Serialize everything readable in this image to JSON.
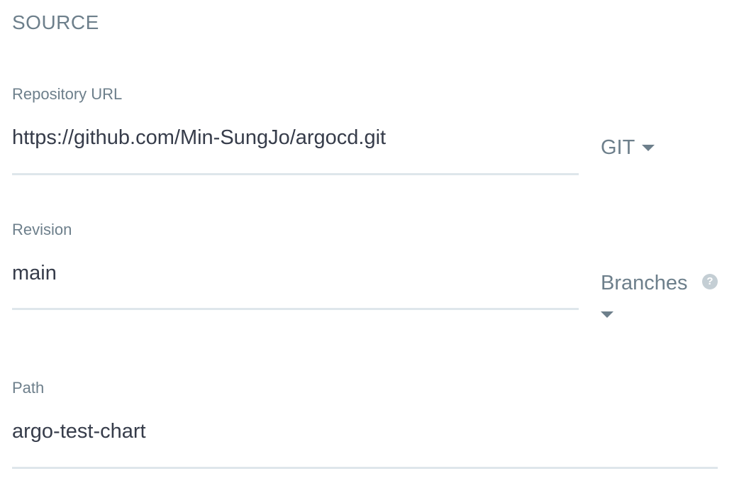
{
  "section": {
    "title": "SOURCE"
  },
  "repository": {
    "label": "Repository URL",
    "value": "https://github.com/Min-SungJo/argocd.git",
    "type_dropdown": "GIT"
  },
  "revision": {
    "label": "Revision",
    "value": "main",
    "selector_label": "Branches",
    "help_icon": "?"
  },
  "path": {
    "label": "Path",
    "value": "argo-test-chart"
  },
  "colors": {
    "label": "#6d7f8b",
    "text": "#363c4a",
    "underline": "#dee6eb",
    "help_icon": "#c4ced4"
  },
  "icons": {
    "dropdown": "caret-down-icon",
    "help": "question-circle-icon"
  }
}
